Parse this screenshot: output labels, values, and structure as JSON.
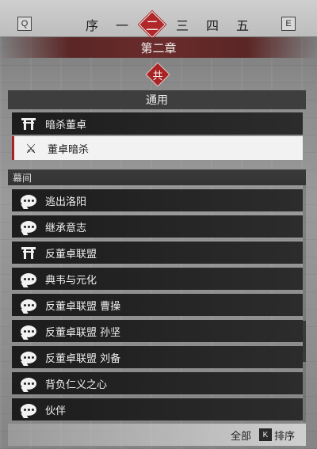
{
  "nav": {
    "prev_key": "Q",
    "next_key": "E",
    "chapters": [
      "序",
      "一",
      "二",
      "三",
      "四",
      "五"
    ],
    "active_chapter_index": 2
  },
  "chapter_title": "第二章",
  "badge": "共",
  "common": {
    "header": "通用",
    "items": [
      {
        "label": "暗杀董卓",
        "icon": "gate-icon"
      },
      {
        "label": "董卓暗杀",
        "icon": "crossed-swords-icon",
        "selected": true
      }
    ]
  },
  "plot": {
    "header": "幕间",
    "items": [
      {
        "label": "逃出洛阳",
        "icon": "speech-bubble-icon"
      },
      {
        "label": "继承意志",
        "icon": "speech-bubble-icon"
      },
      {
        "label": "反董卓联盟",
        "icon": "gate-icon"
      },
      {
        "label": "典韦与元化",
        "icon": "speech-bubble-icon"
      },
      {
        "label": "反董卓联盟 曹操",
        "icon": "speech-bubble-icon"
      },
      {
        "label": "反董卓联盟 孙坚",
        "icon": "speech-bubble-icon"
      },
      {
        "label": "反董卓联盟 刘备",
        "icon": "speech-bubble-icon"
      },
      {
        "label": "背负仁义之心",
        "icon": "speech-bubble-icon"
      },
      {
        "label": "伙伴",
        "icon": "speech-bubble-icon"
      }
    ]
  },
  "footer": {
    "filter_label": "全部",
    "sort_key": "K",
    "sort_label": "排序"
  },
  "scroll_position": 0.6
}
